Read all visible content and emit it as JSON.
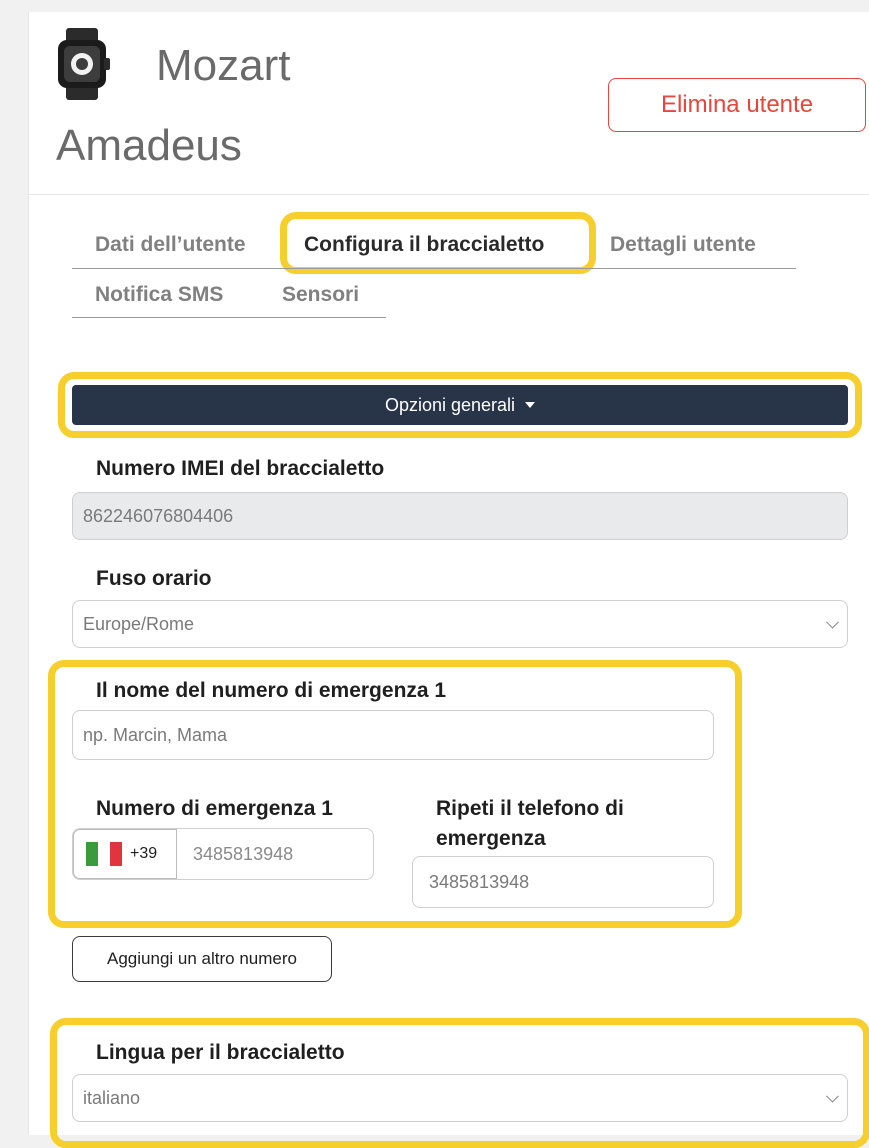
{
  "user": {
    "first_name": "Mozart",
    "last_name": "Amadeus",
    "delete_label": "Elimina utente"
  },
  "tabs": [
    {
      "label": "Dati dell’utente",
      "active": false
    },
    {
      "label": "Configura il braccialetto",
      "active": true
    },
    {
      "label": "Dettagli utente",
      "active": false
    },
    {
      "label": "Notifica SMS",
      "active": false
    },
    {
      "label": "Sensori",
      "active": false
    }
  ],
  "section": {
    "label": "Opzioni generali"
  },
  "imei": {
    "label": "Numero IMEI del braccialetto",
    "value": "862246076804406"
  },
  "timezone": {
    "label": "Fuso orario",
    "value": "Europe/Rome"
  },
  "emergency": {
    "name_label": "Il nome del numero di emergenza 1",
    "name_placeholder": "np. Marcin, Mama",
    "number_label": "Numero di emergenza 1",
    "country_code": "+39",
    "number_value": "3485813948",
    "repeat_label_line1": "Ripeti il telefono di",
    "repeat_label_line2": "emergenza",
    "repeat_value": "3485813948"
  },
  "add_number_label": "Aggiungi un altro numero",
  "language": {
    "label": "Lingua per il braccialetto",
    "value": "italiano"
  },
  "colors": {
    "accent_highlight": "#f7cf2d",
    "danger": "#e8453c",
    "bar": "#283447"
  },
  "icons": {
    "avatar": "smartwatch-icon",
    "flag": "italy-flag-icon"
  }
}
